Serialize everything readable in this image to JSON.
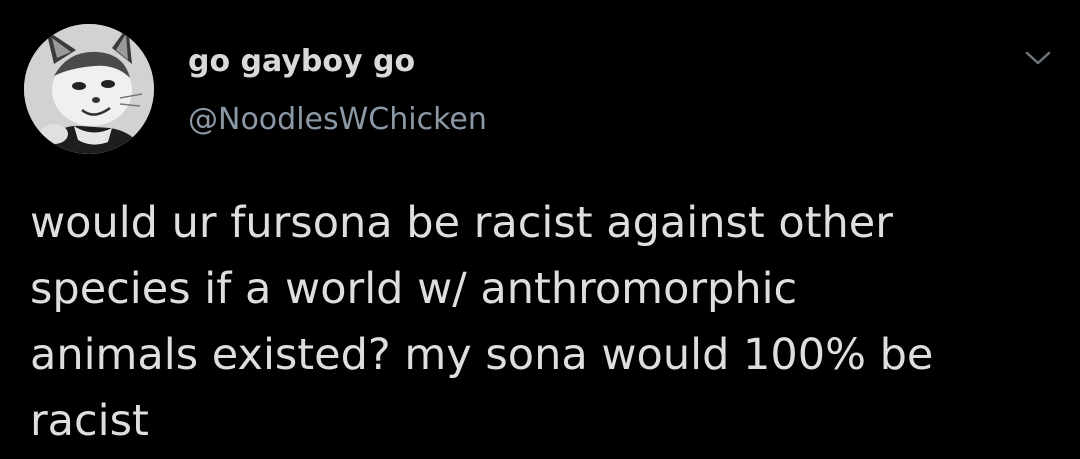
{
  "tweet": {
    "author": {
      "display_name": "go gayboy go",
      "handle": "@NoodlesWChicken",
      "avatar_icon": "anthro-cat-avatar"
    },
    "menu_icon": "chevron-down-icon",
    "text_lines": [
      "would ur fursona be racist against other",
      "species if a world w/ anthromorphic",
      "animals existed? my sona would 100% be",
      "racist"
    ]
  },
  "colors": {
    "background": "#000000",
    "display_name": "#d9d9d9",
    "handle": "#8b98a5",
    "body_text": "#dedede",
    "chevron": "#6e767d"
  }
}
